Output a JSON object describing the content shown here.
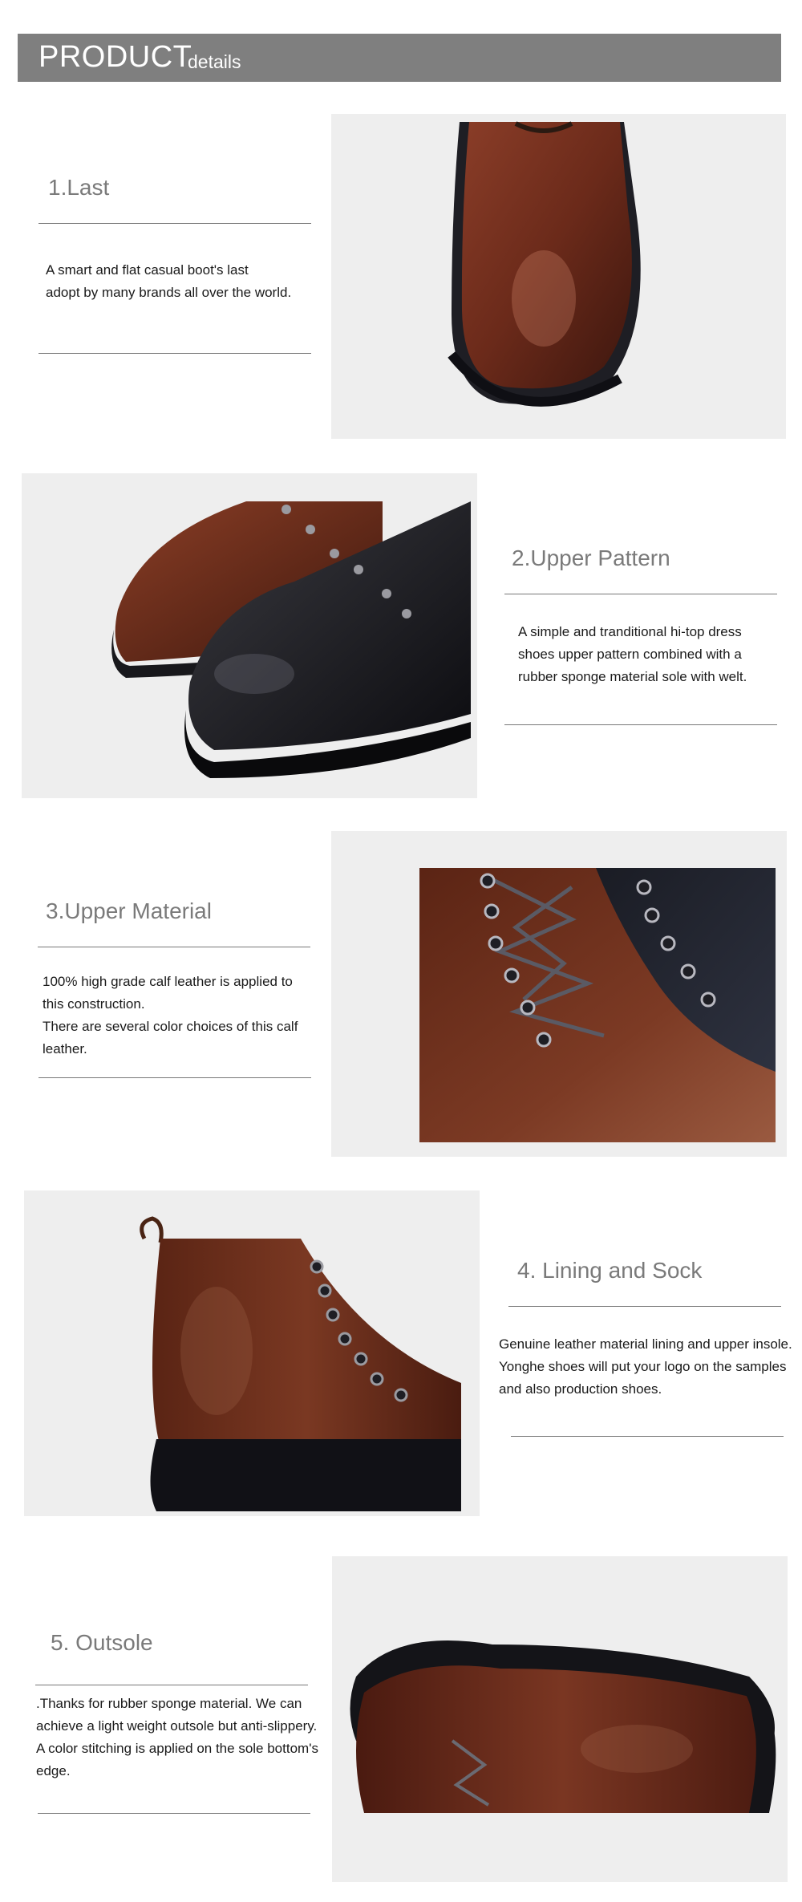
{
  "header": {
    "title_big": "PRODUCT",
    "title_small": "details"
  },
  "sections": [
    {
      "title": "1.Last",
      "lines": [
        "A smart and flat casual boot's last",
        "adopt by many brands all over the world."
      ],
      "image": "brown-shoe-toe-photo"
    },
    {
      "title": "2.Upper Pattern",
      "lines": [
        "A simple and tranditional hi-top dress",
        "shoes upper pattern combined with a",
        "rubber sponge material sole with welt."
      ],
      "image": "brown-and-black-shoes-photo"
    },
    {
      "title": "3.Upper Material",
      "lines": [
        "100% high grade calf leather is applied to",
        "this construction.",
        "There are several color choices of this calf",
        "leather."
      ],
      "image": "lacing-closeup-photo"
    },
    {
      "title": "4. Lining and Sock",
      "lines": [
        "Genuine leather material lining and upper insole.",
        "Yonghe shoes will put your logo on the samples",
        "and also production shoes."
      ],
      "image": "brown-boot-side-photo"
    },
    {
      "title": "5. Outsole",
      "lines": [
        ".Thanks for rubber sponge material. We can",
        "achieve a light weight outsole but anti-slippery.",
        "A color stitching is applied on the sole bottom's",
        "edge."
      ],
      "image": "outsole-view-photo"
    }
  ]
}
